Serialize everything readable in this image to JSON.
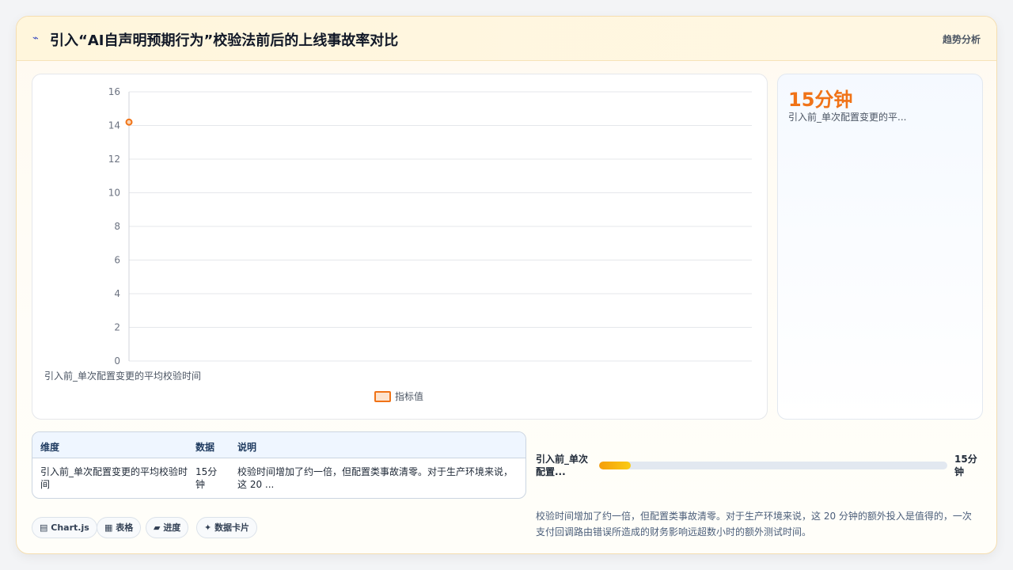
{
  "header": {
    "icon": "chart-icon",
    "title": "引入“AI自声明预期行为”校验法前后的上线事故率对比",
    "right_label": "趋势分析"
  },
  "kpi": {
    "value": "15分钟",
    "label": "引入前_单次配置变更的平..."
  },
  "chart_data": {
    "type": "line",
    "categories": [
      "引入前_单次配置变更的平均校验时间"
    ],
    "series": [
      {
        "name": "指标值",
        "values": [
          14.2
        ],
        "color": "#f07317"
      }
    ],
    "ylim": [
      0,
      16
    ],
    "yticks": [
      0,
      2,
      4,
      6,
      8,
      10,
      12,
      14,
      16
    ],
    "grid": true,
    "legend_position": "bottom"
  },
  "table": {
    "headers": [
      "维度",
      "数据",
      "说明"
    ],
    "rows": [
      [
        "引入前_单次配置变更的平均校验时间",
        "15分钟",
        "校验时间增加了约一倍，但配置类事故清零。对于生产环境来说，这 20 ..."
      ]
    ]
  },
  "progress": {
    "label": "引入前_单次配置...",
    "value": "15分钟",
    "fraction": 0.09
  },
  "note": "校验时间增加了约一倍，但配置类事故清零。对于生产环境来说，这 20 分钟的额外投入是值得的，一次支付回调路由错误所造成的财务影响远超数小时的额外测试时间。",
  "tags": [
    {
      "icon": "chart-icon",
      "label": "Chart.js"
    },
    {
      "icon": "table-icon",
      "label": "表格"
    },
    {
      "icon": "progress-icon",
      "label": "进度"
    },
    {
      "icon": "card-icon",
      "label": "数据卡片"
    }
  ],
  "colors": {
    "accent": "#f07317",
    "header_bg": "#fff6dc",
    "table_head_bg": "#eff6ff"
  }
}
